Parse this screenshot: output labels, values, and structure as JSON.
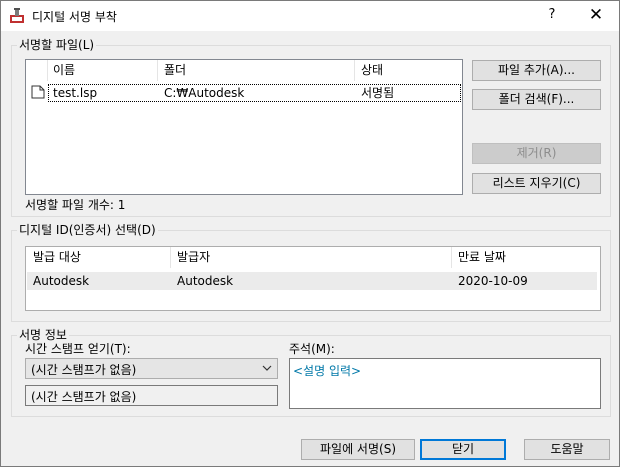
{
  "window": {
    "title": "디지털 서명 부착",
    "help": "?",
    "close": "✕"
  },
  "files_group": {
    "label": "서명할 파일(L)",
    "columns": [
      "이름",
      "폴더",
      "상태"
    ],
    "rows": [
      {
        "name": "test.lsp",
        "folder": "C:₩Autodesk",
        "status": "서명됨"
      }
    ],
    "count_text": "서명할 파일 개수: 1",
    "buttons": {
      "add_file": "파일 추가(A)...",
      "browse_folder": "폴더 검색(F)...",
      "remove": "제거(R)",
      "clear_list": "리스트 지우기(C)"
    }
  },
  "cert_group": {
    "label": "디지털 ID(인증서) 선택(D)",
    "columns": [
      "발급 대상",
      "발급자",
      "만료 날짜"
    ],
    "rows": [
      {
        "issued_to": "Autodesk",
        "issuer": "Autodesk",
        "expires": "2020-10-09"
      }
    ]
  },
  "sign_info": {
    "label": "서명 정보",
    "timestamp_label": "시간 스탬프 얻기(T):",
    "timestamp_value": "(시간 스탬프가 없음)",
    "timestamp_display": "(시간 스탬프가 없음)",
    "comment_label": "주석(M):",
    "comment_placeholder": "<설명 입력>"
  },
  "footer": {
    "sign_files": "파일에 서명(S)",
    "close": "닫기",
    "help": "도움말"
  }
}
